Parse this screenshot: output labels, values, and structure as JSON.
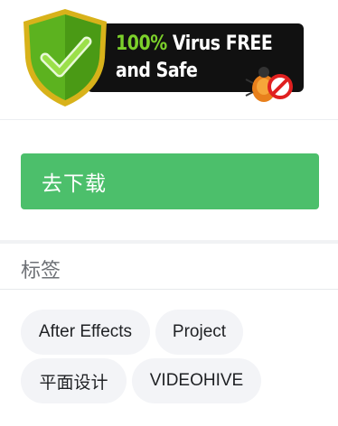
{
  "badge": {
    "line1_percent": "100%",
    "line1_rest": " Virus FREE",
    "line2": "and Safe",
    "shield_icon": "check-shield-icon",
    "bug_icon": "no-bug-icon",
    "colors": {
      "shield_green": "#5cb21f",
      "shield_gold": "#d8b21a",
      "check_green": "#7cd12b",
      "bar": "#111111"
    }
  },
  "download": {
    "button_label": "去下载",
    "color": "#4cbf6b"
  },
  "tags": {
    "title": "标签",
    "items": [
      {
        "label": "After Effects"
      },
      {
        "label": "Project"
      },
      {
        "label": "平面设计"
      },
      {
        "label": "VIDEOHIVE"
      }
    ]
  }
}
